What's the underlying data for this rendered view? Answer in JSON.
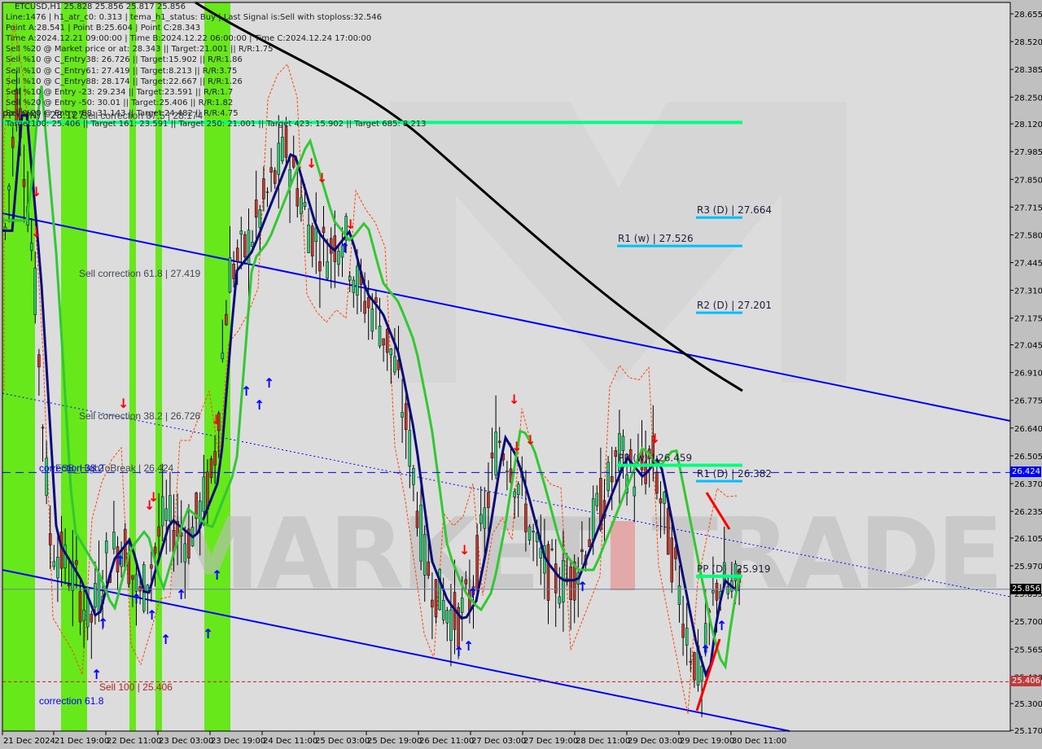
{
  "chart_data": {
    "type": "candlestick",
    "symbol": "ETCUSD",
    "timeframe": "H1",
    "ohlc_header": {
      "open": "25.828",
      "high": "25.856",
      "low": "25.817",
      "close": "25.856"
    },
    "info_lines": [
      "Line:1476 | h1_atr_c0: 0.313 | tema_h1_status: Buy | Last Signal is:Sell with stoploss:32.546",
      "Point A:28.541 | Point B:25.604 | Point C:28.343",
      "Time A:2024.12.21 09:00:00 | Time B:2024.12.22 06:00:00 | Time C:2024.12.24 17:00:00",
      "Sell %20 @ Market price or at: 28.343 || Target:21.001 || R/R:1.75",
      "Sell %10 @ C_Entry38: 26.726 || Target:15.902 || R/R:1.86",
      "Sell %10 @ C_Entry61: 27.419 || Target:8.213 || R/R:3.75",
      "Sell %10 @ C_Entry88: 28.174 || Target:22.667 || R/R:1.26",
      "Sell %10 @ Entry -23: 29.234 || Target:23.591 || R/R:1.7",
      "Sell %20 @ Entry -50: 30.01 || Target:25.406 || R/R:1.82",
      "Sell %20 @ Entry -88: 31.143 || Target:24.482 || R/R:4.75",
      "Target100: 25.406 || Target 161: 23.591 || Target 250: 21.001 || Target 423: 15.902 || Target 685: 8.213"
    ],
    "y_axis": {
      "range": [
        25.17,
        28.7
      ],
      "ticks": [
        "28.655",
        "28.520",
        "28.385",
        "28.250",
        "28.120",
        "27.985",
        "27.850",
        "27.715",
        "27.580",
        "27.445",
        "27.310",
        "27.175",
        "27.045",
        "26.910",
        "26.775",
        "26.640",
        "26.505",
        "26.370",
        "26.235",
        "26.105",
        "25.970",
        "25.835",
        "25.700",
        "25.565",
        "25.430",
        "25.300",
        "25.170"
      ]
    },
    "x_axis": {
      "ticks": [
        "21 Dec 2024",
        "21 Dec 19:00",
        "22 Dec 11:00",
        "23 Dec 03:00",
        "23 Dec 19:00",
        "24 Dec 11:00",
        "25 Dec 03:00",
        "25 Dec 19:00",
        "26 Dec 11:00",
        "27 Dec 03:00",
        "27 Dec 19:00",
        "28 Dec 11:00",
        "29 Dec 03:00",
        "29 Dec 19:00",
        "30 Dec 11:00"
      ]
    },
    "price_tags": [
      {
        "label": "26.424",
        "value": 26.424,
        "color": "#0000ff"
      },
      {
        "label": "25.856",
        "value": 25.856,
        "color": "#000000"
      },
      {
        "label": "25.406",
        "value": 25.406,
        "color": "#c03c3c"
      }
    ],
    "levels": [
      {
        "label": "PP (MN) | 28.127",
        "value": 28.127,
        "color": "#00ff7f"
      },
      {
        "label": "R3 (D) | 27.664",
        "value": 27.664,
        "color": "#00bfff"
      },
      {
        "label": "R1 (w) | 27.526",
        "value": 27.526,
        "color": "#00bfff"
      },
      {
        "label": "R2 (D) | 27.201",
        "value": 27.201,
        "color": "#00bfff"
      },
      {
        "label": "PP (w) | 26.459",
        "value": 26.459,
        "color": "#00ff7f"
      },
      {
        "label": "R1 (D) | 26.382",
        "value": 26.382,
        "color": "#00bfff"
      },
      {
        "label": "PP (D) | 25.919",
        "value": 25.919,
        "color": "#00ff7f"
      }
    ],
    "annotations": [
      {
        "label": "Sell correction 61.8 | 27.419",
        "value": 27.419
      },
      {
        "label": "Sell correction 38.2 | 26.726",
        "value": 26.726
      },
      {
        "label": "FSB_HighToBreak | 26.424",
        "value": 26.424
      },
      {
        "label": "correction 38.2",
        "value": 26.424
      },
      {
        "label": "Sell 100 | 25.406",
        "value": 25.406
      },
      {
        "label": "correction 61.8",
        "value": 25.3
      },
      {
        "label": "Sell correction 87.5 | 28.174",
        "value": 28.174
      }
    ],
    "watermark": "MARKETTRADE",
    "last_price": 25.856
  }
}
